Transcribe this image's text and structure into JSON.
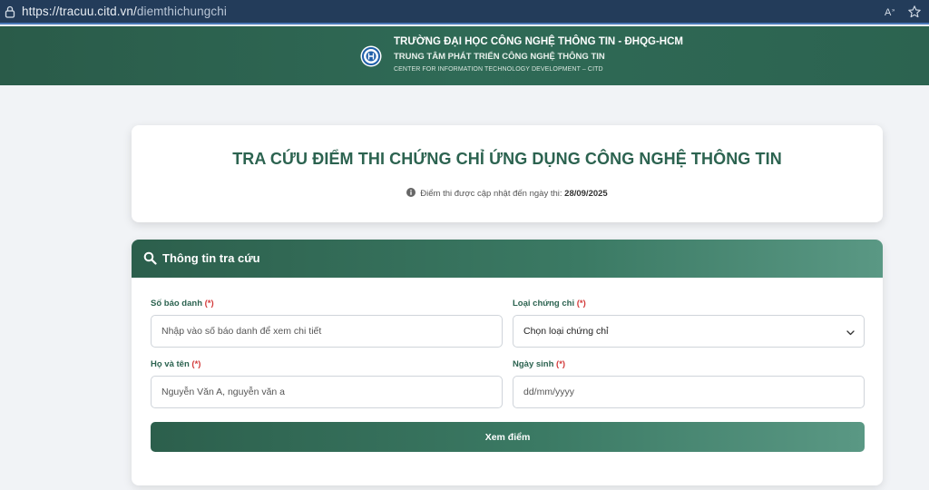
{
  "browser": {
    "url_host": "https://tracuu.citd.vn/",
    "url_path": "diemthichungchi"
  },
  "header": {
    "line1": "TRƯỜNG ĐẠI HỌC CÔNG NGHỆ THÔNG TIN - ĐHQG-HCM",
    "line2": "TRUNG TÂM PHÁT TRIỂN CÔNG NGHỆ THÔNG TIN",
    "line3": "CENTER FOR INFORMATION TECHNOLOGY DEVELOPMENT – CITD"
  },
  "title_card": {
    "title": "TRA CỨU ĐIỂM THI CHỨNG CHỈ ỨNG DỤNG CÔNG NGHỆ THÔNG TIN",
    "update_text": "Điểm thi được cập nhật đến ngày thi:",
    "update_date": "28/09/2025"
  },
  "form": {
    "title": "Thông tin tra cứu",
    "required_mark": "(*)",
    "sbd": {
      "label": "Số báo danh",
      "placeholder": "Nhập vào số báo danh để xem chi tiết"
    },
    "cert_type": {
      "label": "Loại chứng chỉ",
      "selected": "Chọn loại chứng chỉ"
    },
    "fullname": {
      "label": "Họ và tên",
      "placeholder": "Nguyễn Văn A, nguyễn văn a"
    },
    "dob": {
      "label": "Ngày sinh",
      "placeholder": "dd/mm/yyyy"
    },
    "submit_label": "Xem điểm"
  },
  "colors": {
    "brand_green": "#2c6350",
    "required_red": "#d33a3a",
    "address_bar": "#233c5a"
  },
  "icons": {
    "lock": "lock-icon",
    "reader": "reader-mode-icon",
    "favorite": "star-icon",
    "logo": "citd-logo",
    "info": "info-icon",
    "search": "search-icon",
    "dropdown": "chevron-down-icon"
  }
}
